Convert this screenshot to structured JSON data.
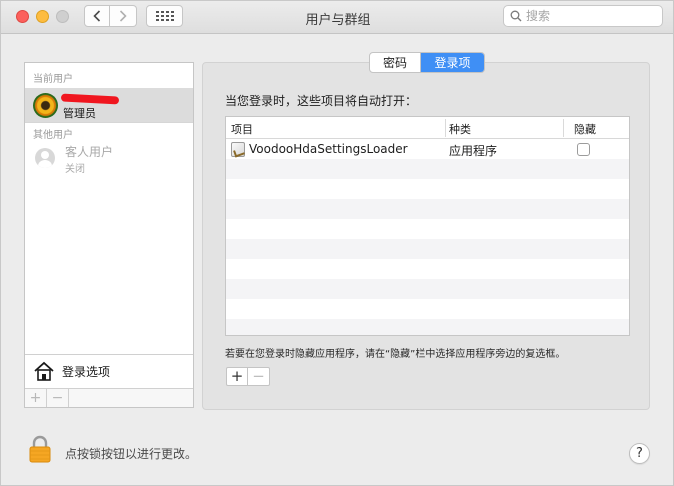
{
  "window": {
    "title": "用户与群组",
    "search_placeholder": "搜索"
  },
  "toolbar": {
    "back_icon": "chevron-left-icon",
    "forward_icon": "chevron-right-icon",
    "show_all_icon": "grid-icon"
  },
  "sidebar": {
    "current_users_label": "当前用户",
    "admin": {
      "role": "管理员"
    },
    "other_users_label": "其他用户",
    "guest": {
      "name": "客人用户",
      "status": "关闭"
    },
    "login_options_label": "登录选项",
    "add_label": "+",
    "remove_label": "−"
  },
  "tabs": [
    {
      "label": "密码",
      "selected": false
    },
    {
      "label": "登录项",
      "selected": true
    }
  ],
  "login_items": {
    "intro": "当您登录时，这些项目将自动打开：",
    "columns": [
      "项目",
      "种类",
      "隐藏"
    ],
    "rows": [
      {
        "item": "VoodooHdaSettingsLoader",
        "kind": "应用程序",
        "hidden": false
      }
    ],
    "hint": "若要在您登录时隐藏应用程序，请在“隐藏”栏中选择应用程序旁边的复选框。",
    "add_label": "+",
    "remove_label": "−"
  },
  "footer": {
    "lock_text": "点按锁按钮以进行更改。",
    "help_label": "?"
  },
  "colors": {
    "accent": "#3f8ff5",
    "close": "#fc605c",
    "minimize": "#fdbc40",
    "lock": "#f5a623"
  }
}
